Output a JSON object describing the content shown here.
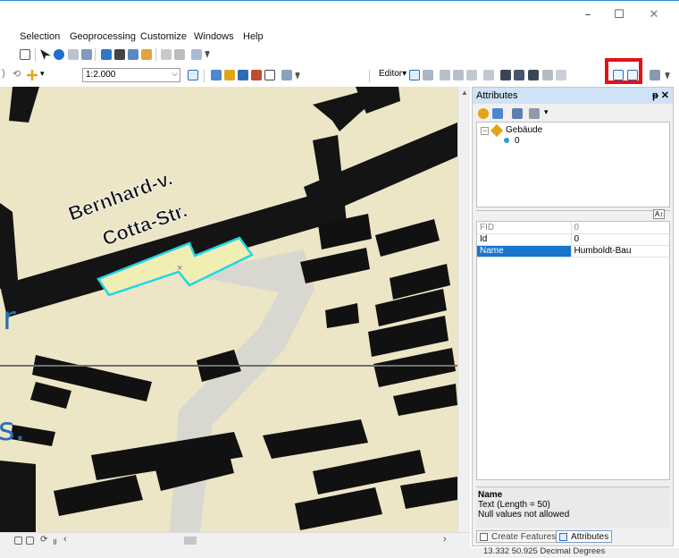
{
  "window": {
    "minimize": "–",
    "maximize": "☐",
    "close": "✕"
  },
  "menu": [
    "Selection",
    "Geoprocessing",
    "Customize",
    "Windows",
    "Help"
  ],
  "toolbar": {
    "scale_value": "1:2.000",
    "editor_label": "Editor▾"
  },
  "map": {
    "street_label_line1": "Bernhard-v.",
    "street_label_line2": "Cotta-Str."
  },
  "overlay_fragments": {
    "r": "r",
    "s": "s."
  },
  "attributes": {
    "title": "Attributes",
    "pin": "ᵽ ✕",
    "tree": {
      "layer": "Gebäude",
      "feature": "0"
    },
    "rows": [
      {
        "field": "FID",
        "value": "0",
        "disabled": true
      },
      {
        "field": "Id",
        "value": "0",
        "disabled": false
      },
      {
        "field": "Name",
        "value": "Humboldt-Bau",
        "selected": true
      }
    ],
    "description": {
      "title": "Name",
      "line1": "Text (Length = 50)",
      "line2": "Null values not allowed"
    },
    "tabs": {
      "create": "Create Features",
      "attributes": "Attributes"
    }
  },
  "status": {
    "coords": "13.332  50.925 Decimal Degrees"
  },
  "colors": {
    "highlight_box": "#e5111a",
    "selection_outline": "#1fd6e6",
    "row_selected": "#1874cd"
  }
}
